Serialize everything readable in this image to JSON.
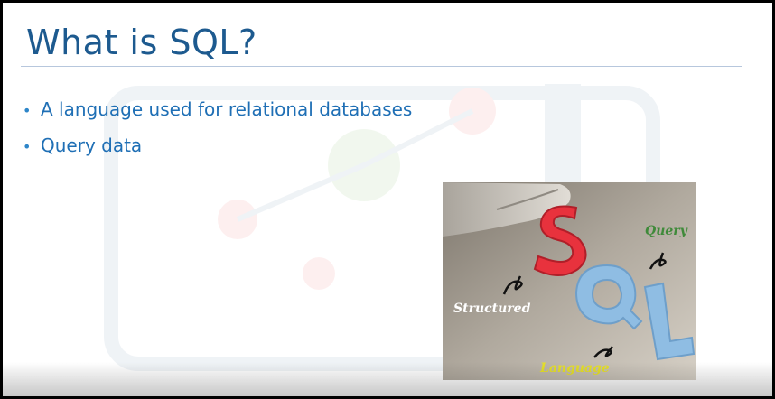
{
  "slide": {
    "title": "What is SQL?",
    "bullets": [
      "A language used for relational databases",
      "Query data"
    ],
    "bullet_glyph": "•"
  },
  "image": {
    "words": {
      "query": "Query",
      "structured": "Structured",
      "language": "Language"
    },
    "letters": [
      "S",
      "Q",
      "L"
    ]
  },
  "colors": {
    "title": "#1d5a8f",
    "bullet_text": "#1f6fb5",
    "letter_s": "#e8323d",
    "letter_q_l": "#8fbde3"
  }
}
